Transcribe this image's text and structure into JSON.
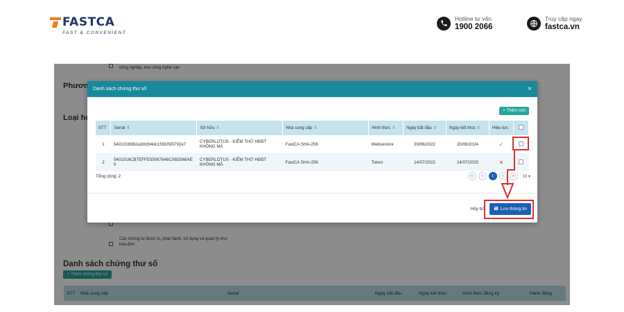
{
  "banner": {
    "logo_text": "FASTCA",
    "logo_tagline": "FAST & CONVENIENT",
    "hotline_label": "Hotline tư vấn",
    "hotline_value": "1900 2066",
    "site_label": "Truy cập ngay",
    "site_value": "fastca.vn"
  },
  "background": {
    "top_text": "công nghiệp, khu công nghệ cao",
    "heading_phuong": "Phương",
    "heading_loai": "Loại hóa",
    "checkbox_text_1": "Các chứng từ được in, phát hành, sử dụng và quản lý như",
    "checkbox_text_2": "hóa đơn",
    "section_title": "Danh sách chứng thư số",
    "add_button": "Thêm chứng thư số",
    "table_headers": {
      "stt": "STT",
      "provider": "Nhà cung cấp",
      "serial": "Serial",
      "start": "Ngày bắt đầu",
      "end": "Ngày kết thúc",
      "form": "Hình thức đăng ký",
      "action": "Hành động"
    }
  },
  "modal": {
    "title": "Danh sách chứng thư số",
    "close": "×",
    "add_button": "Thêm mới",
    "columns": {
      "stt": "STT",
      "serial": "Serial",
      "owner": "Sở hữu",
      "provider": "Nhà cung cấp",
      "form": "Hình thức",
      "start": "Ngày bắt đầu",
      "end": "Ngày kết thúc",
      "valid": "Hiệu lực"
    },
    "rows": [
      {
        "stt": "1",
        "serial": "5401016982a3dcfd4dc1f3925f0792e7",
        "owner_line1": "CYBERLOTUS - KIỂM THỬ HĐĐT",
        "owner_line2": "KHÔNG MÃ",
        "provider": "FastCA SHA-256",
        "form": "Webservice",
        "start": "20/06/2022",
        "end": "20/06/2024"
      },
      {
        "stt": "2",
        "serial_line1": "5401016CB7EFFE55067648C06D568AE",
        "serial_line2": "0",
        "owner_line1": "CYBERLOTUS - KIỂM THỬ HĐĐT",
        "owner_line2": "KHÔNG MÃ",
        "provider": "FastCA SHA-256",
        "form": "Token",
        "start": "14/07/2022",
        "end": "14/07/2025"
      }
    ],
    "total_label": "Tổng cộng: 2",
    "pager": {
      "first": "«",
      "prev": "‹",
      "current": "1",
      "next": "›",
      "last": "»",
      "page_size": "10"
    },
    "cancel_button": "Hủy bỏ",
    "save_button": "Lưu thông tin"
  },
  "colors": {
    "header": "#17899b",
    "primary": "#1e5fb4",
    "success": "#26a69a",
    "highlight": "#d92f2f"
  }
}
